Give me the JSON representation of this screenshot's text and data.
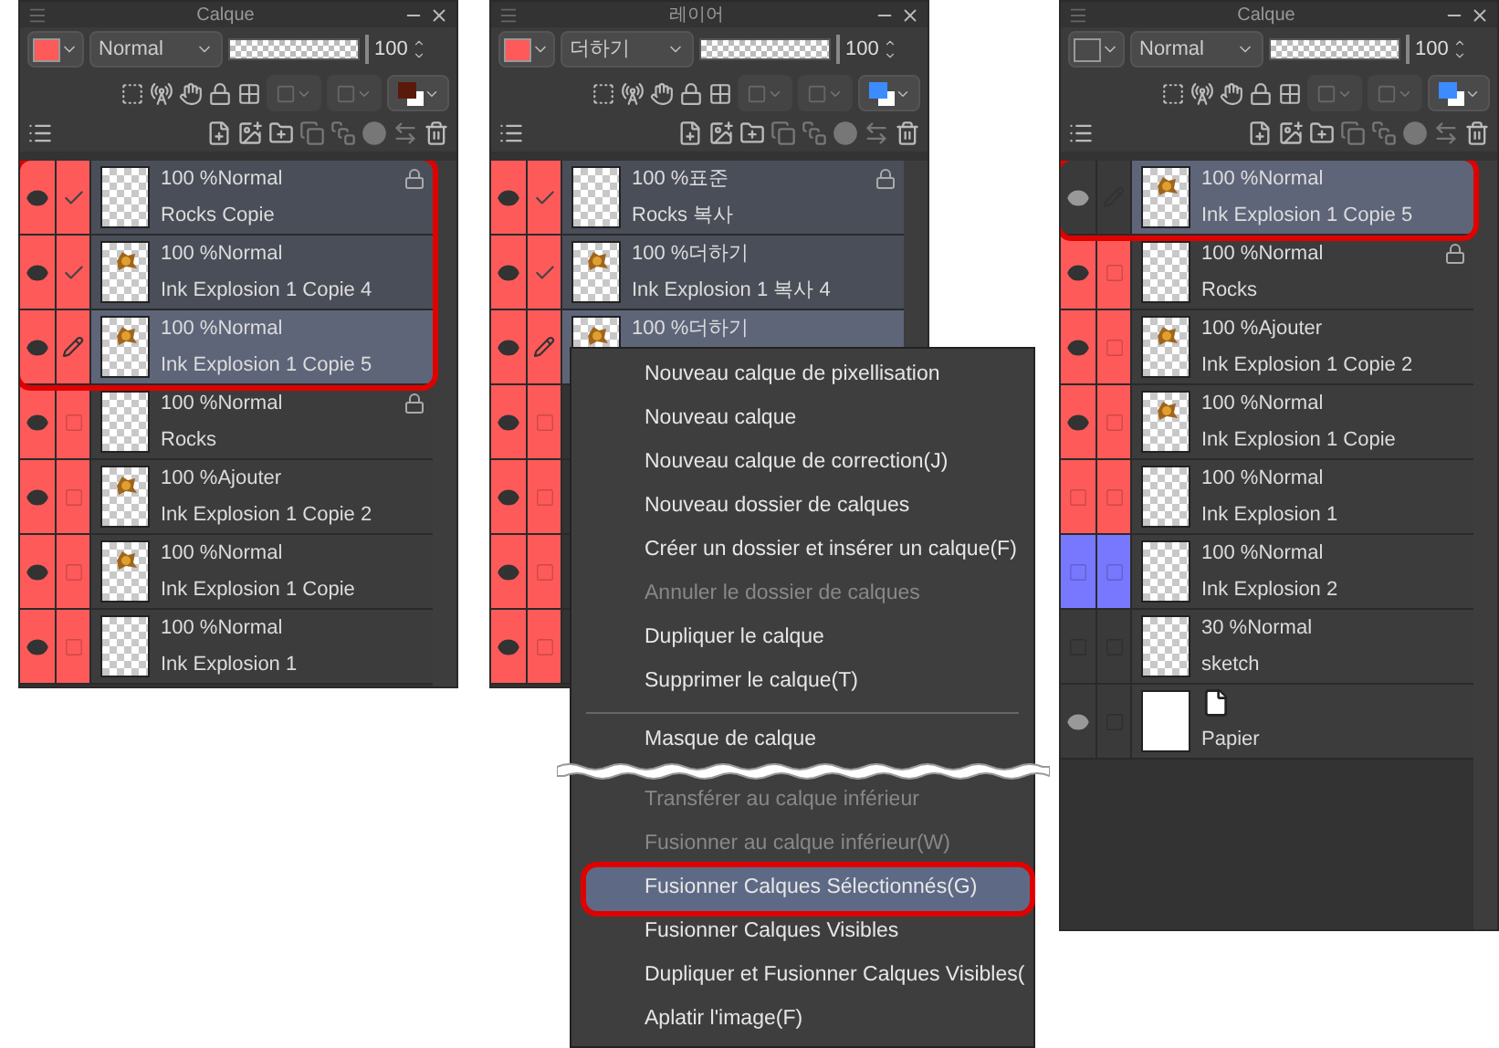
{
  "panels": [
    {
      "title": "Calque",
      "swatch": {
        "color": "#ff5a5a"
      },
      "blend_mode": "Normal",
      "opacity": {
        "value": "100",
        "level": 1
      },
      "color_swatch": {
        "color": "#5a1a0a"
      },
      "layers": [
        {
          "kind": "empty",
          "mode": "100 %Normal",
          "name": "Rocks Copie",
          "color": "#ff5a5a",
          "visible": true,
          "checked": true,
          "locked": true,
          "selected": true,
          "current": false,
          "outlined": true
        },
        {
          "kind": "ink",
          "mode": "100 %Normal",
          "name": "Ink Explosion 1 Copie 4",
          "color": "#ff5a5a",
          "visible": true,
          "checked": true,
          "locked": false,
          "selected": true,
          "current": false,
          "outlined": true
        },
        {
          "kind": "ink",
          "mode": "100 %Normal",
          "name": "Ink Explosion 1 Copie 5",
          "color": "#ff5a5a",
          "visible": true,
          "locked": false,
          "selected": true,
          "current": true,
          "outlined": true
        },
        {
          "kind": "empty",
          "mode": "100 %Normal",
          "name": "Rocks",
          "color": "#ff5a5a",
          "visible": true,
          "checked": false,
          "locked": true,
          "selected": false,
          "current": false,
          "outlined": false
        },
        {
          "kind": "ink",
          "mode": "100 %Ajouter",
          "name": "Ink Explosion 1 Copie 2",
          "color": "#ff5a5a",
          "visible": true,
          "checked": false,
          "locked": false,
          "selected": false,
          "current": false,
          "outlined": false
        },
        {
          "kind": "ink",
          "mode": "100 %Normal",
          "name": "Ink Explosion 1 Copie",
          "color": "#ff5a5a",
          "visible": true,
          "checked": false,
          "locked": false,
          "selected": false,
          "current": false,
          "outlined": false
        },
        {
          "kind": "empty",
          "mode": "100 %Normal",
          "name": "Ink Explosion 1",
          "color": "#ff5a5a",
          "visible": true,
          "checked": false,
          "locked": false,
          "selected": false,
          "current": false,
          "outlined": false
        }
      ]
    },
    {
      "title": "레이어",
      "swatch": {
        "color": "#ff5a5a"
      },
      "blend_mode": "더하기",
      "opacity": {
        "value": "100",
        "level": 1
      },
      "color_swatch": {
        "color": "#3c8cff"
      },
      "layers": [
        {
          "kind": "empty",
          "mode": "100 %표준",
          "name": "Rocks 복사",
          "color": "#ff5a5a",
          "visible": true,
          "checked": true,
          "locked": true,
          "selected": true,
          "current": false
        },
        {
          "kind": "ink",
          "mode": "100 %더하기",
          "name": "Ink Explosion 1 복사 4",
          "color": "#ff5a5a",
          "visible": true,
          "checked": true,
          "locked": false,
          "selected": true,
          "current": false
        },
        {
          "kind": "ink",
          "mode": "100 %더하기",
          "color": "#ff5a5a",
          "visible": true,
          "selected": true,
          "current": true
        },
        {
          "color": "#ff5a5a",
          "visible": true,
          "checked": false
        },
        {
          "color": "#ff5a5a",
          "visible": true,
          "checked": false
        },
        {
          "color": "#ff5a5a",
          "visible": true,
          "checked": false
        },
        {
          "color": "#ff5a5a",
          "visible": true,
          "checked": false
        }
      ]
    },
    {
      "title": "Calque",
      "blend_mode": "Normal",
      "opacity": {
        "value": "100",
        "level": 1
      },
      "color_swatch": {
        "color": "#3c8cff"
      },
      "layers": [
        {
          "kind": "ink",
          "mode": "100 %Normal",
          "name": "Ink Explosion 1 Copie 5",
          "visible": true,
          "locked": false,
          "selected": true,
          "current": true,
          "outlined": true
        },
        {
          "kind": "empty",
          "mode": "100 %Normal",
          "name": "Rocks",
          "color": "#ff5a5a",
          "visible": true,
          "checked": false,
          "locked": true,
          "selected": false,
          "current": false,
          "outlined": false
        },
        {
          "kind": "ink",
          "mode": "100 %Ajouter",
          "name": "Ink Explosion 1 Copie 2",
          "color": "#ff5a5a",
          "visible": true,
          "checked": false,
          "locked": false,
          "selected": false,
          "current": false,
          "outlined": false
        },
        {
          "kind": "ink",
          "mode": "100 %Normal",
          "name": "Ink Explosion 1 Copie",
          "color": "#ff5a5a",
          "visible": true,
          "checked": false,
          "locked": false,
          "selected": false,
          "current": false,
          "outlined": false
        },
        {
          "kind": "empty",
          "mode": "100 %Normal",
          "name": "Ink Explosion 1",
          "color": "#ff5a5a",
          "visible": false,
          "checked": false,
          "locked": false,
          "selected": false,
          "current": false,
          "outlined": false
        },
        {
          "kind": "empty",
          "mode": "100 %Normal",
          "name": "Ink Explosion 2",
          "color": "#7878ff",
          "visible": false,
          "checked": false,
          "locked": false,
          "selected": false,
          "current": false,
          "outlined": false
        },
        {
          "kind": "empty",
          "mode": "30 %Normal",
          "name": "sketch",
          "visible": false,
          "checked": false,
          "locked": false,
          "selected": false,
          "current": false,
          "outlined": false
        },
        {
          "kind": "paper",
          "name": "Papier",
          "visible": true,
          "checked": false,
          "locked": false,
          "selected": false,
          "current": false,
          "outlined": false
        }
      ]
    }
  ],
  "context_menu": {
    "items": [
      {
        "kind": "item",
        "label": "Nouveau calque de pixellisation",
        "disabled": false,
        "selected": false,
        "outlined": false
      },
      {
        "kind": "item",
        "label": "Nouveau calque",
        "disabled": false,
        "selected": false,
        "outlined": false
      },
      {
        "kind": "item",
        "label": "Nouveau calque de correction(J)",
        "disabled": false,
        "selected": false,
        "outlined": false
      },
      {
        "kind": "item",
        "label": "Nouveau dossier de calques",
        "disabled": false,
        "selected": false,
        "outlined": false
      },
      {
        "kind": "item",
        "label": "Créer un dossier et insérer un calque(F)",
        "disabled": false,
        "selected": false,
        "outlined": false
      },
      {
        "kind": "item",
        "label": "Annuler le dossier de calques",
        "disabled": true,
        "selected": false,
        "outlined": false
      },
      {
        "kind": "item",
        "label": "Dupliquer le calque",
        "disabled": false,
        "selected": false,
        "outlined": false
      },
      {
        "kind": "item",
        "label": "Supprimer le calque(T)",
        "disabled": false,
        "selected": false,
        "outlined": false
      },
      {
        "kind": "separator"
      },
      {
        "kind": "item",
        "label": "Masque de calque",
        "disabled": false,
        "selected": false,
        "outlined": false
      },
      {
        "kind": "tear"
      },
      {
        "kind": "item",
        "label": "Transférer au calque inférieur",
        "disabled": true,
        "selected": false,
        "outlined": false
      },
      {
        "kind": "item",
        "label": "Fusionner au calque inférieur(W)",
        "disabled": true,
        "selected": false,
        "outlined": false
      },
      {
        "kind": "item",
        "label": "Fusionner Calques Sélectionnés(G)",
        "disabled": false,
        "selected": true,
        "outlined": true
      },
      {
        "kind": "item",
        "label": "Fusionner Calques Visibles",
        "disabled": false,
        "selected": false,
        "outlined": false
      },
      {
        "kind": "item",
        "label": "Dupliquer et Fusionner Calques Visibles(",
        "disabled": false,
        "selected": false,
        "outlined": false
      },
      {
        "kind": "item",
        "label": "Aplatir l'image(F)",
        "disabled": false,
        "selected": false,
        "outlined": false
      }
    ]
  }
}
